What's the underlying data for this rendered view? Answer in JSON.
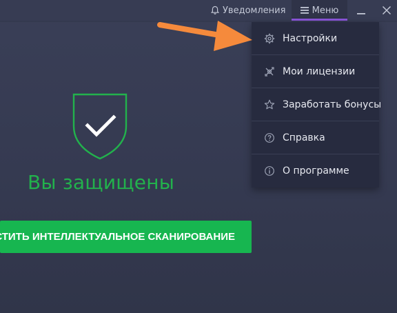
{
  "titlebar": {
    "notifications_label": "Уведомления",
    "menu_label": "Меню"
  },
  "status": {
    "protected_text": "Вы защищены"
  },
  "scan_button": {
    "label": "СТИТЬ ИНТЕЛЛЕКТУАЛЬНОЕ СКАНИРОВАНИЕ"
  },
  "menu": {
    "items": [
      {
        "label": "Настройки",
        "icon": "gear-icon"
      },
      {
        "label": "Мои лицензии",
        "icon": "licenses-icon"
      },
      {
        "label": "Заработать бонусы",
        "icon": "star-icon"
      },
      {
        "label": "Справка",
        "icon": "help-icon"
      },
      {
        "label": "О программе",
        "icon": "info-icon"
      }
    ]
  },
  "colors": {
    "accent_green": "#17b650",
    "protected_green": "#22b24c",
    "menu_underline": "#8a55d8",
    "annotation_arrow": "#f58a3c",
    "background": "#363b52"
  }
}
